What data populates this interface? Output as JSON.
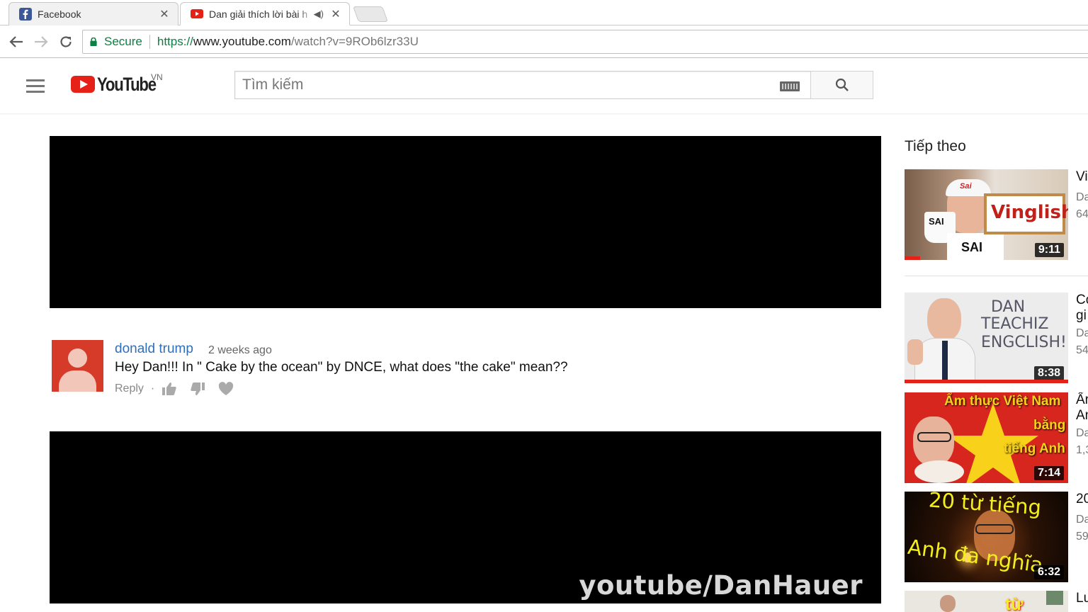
{
  "browser": {
    "tabs": [
      {
        "title": "Facebook"
      },
      {
        "title": "Dan giải thích lời bài h"
      }
    ],
    "secure_label": "Secure",
    "url_scheme": "https://",
    "url_host": "www.youtube.com",
    "url_path": "/watch?v=9ROb6lzr33U"
  },
  "masthead": {
    "logo_text": "YouTube",
    "country_code": "VN",
    "search_placeholder": "Tìm kiếm"
  },
  "comment": {
    "author": "donald trump",
    "time": "2 weeks ago",
    "text": "Hey Dan!!! In \" Cake by the ocean\" by DNCE, what does \"the cake\" mean??",
    "reply_label": "Reply"
  },
  "watermark": "youtube/DanHauer",
  "sidebar": {
    "title": "Tiếp theo",
    "items": [
      {
        "title": "Vi",
        "channel": "Da",
        "views": "64",
        "duration": "9:11",
        "thumb_text": [
          "Sai",
          "SAI",
          "Vinglish",
          "SAI"
        ]
      },
      {
        "title": "Co",
        "title2": "gi",
        "channel": "Da",
        "views": "54",
        "duration": "8:38",
        "thumb_text": [
          "DAN",
          "TEACHIZ",
          "ENGCLISH!"
        ]
      },
      {
        "title": "Ẩr",
        "title2": "An",
        "channel": "Da",
        "views": "1,3",
        "duration": "7:14",
        "thumb_text": [
          "Ẩm thực Việt Nam",
          "bằng",
          "tiếng Anh"
        ]
      },
      {
        "title": "20",
        "channel": "Da",
        "views": "59",
        "duration": "6:32",
        "thumb_text": [
          "20 từ tiếng",
          "Anh đa nghĩa"
        ]
      },
      {
        "title": "Lu",
        "thumb_text": [
          "từ"
        ]
      }
    ]
  },
  "colors": {
    "youtube_red": "#e62117",
    "link_blue": "#2f6fb8",
    "secure_green": "#0b8043"
  }
}
